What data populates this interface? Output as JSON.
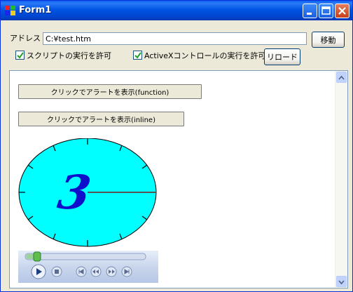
{
  "window": {
    "title": "Form1"
  },
  "address": {
    "label": "アドレス",
    "value": "C:¥test.htm",
    "go_label": "移動"
  },
  "options": {
    "script_label": "スクリプトの実行を許可",
    "activex_label": "ActiveXコントロールの実行を許可",
    "script_checked": true,
    "activex_checked": true,
    "reload_label": "リロード"
  },
  "page": {
    "button_function_label": "クリックでアラートを表示(function)",
    "button_inline_label": "クリックでアラートを表示(inline)"
  },
  "clock": {
    "hour_digit": "3",
    "face_color": "#00ffff"
  },
  "media_player": {
    "seek_fraction": 0.1
  },
  "colors": {
    "titlebar": "#0054e3",
    "face": "#ece9d8"
  }
}
